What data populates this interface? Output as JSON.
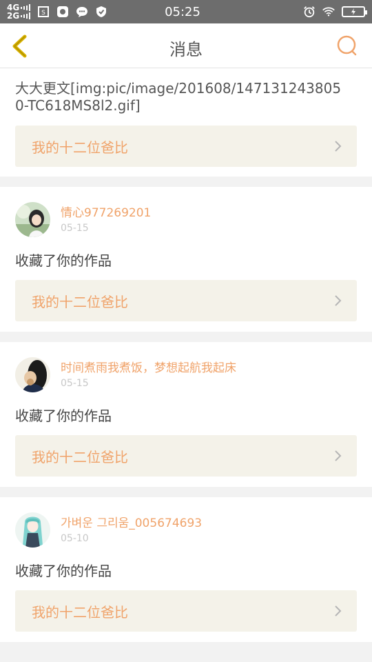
{
  "status_bar": {
    "net_top": "4G",
    "net_bottom": "2G",
    "time": "05:25"
  },
  "header": {
    "title": "消息"
  },
  "first_message": {
    "text": "大大更文[img:pic/image/201608/1471312438050-TC618MS8l2.gif]",
    "work_title": "我的十二位爸比"
  },
  "messages": [
    {
      "username": "情心977269201",
      "date": "05-15",
      "action": "收藏了你的作品",
      "work_title": "我的十二位爸比"
    },
    {
      "username": "时间煮雨我煮饭，梦想起航我起床",
      "date": "05-15",
      "action": "收藏了你的作品",
      "work_title": "我的十二位爸比"
    },
    {
      "username": "가벼운 그리움_005674693",
      "date": "05-10",
      "action": "收藏了你的作品",
      "work_title": "我的十二位爸比"
    }
  ],
  "colors": {
    "accent": "#f0a36a",
    "back_icon": "#d8b200",
    "status_bar": "#6d6d6d",
    "work_box_bg": "#f4f2e9"
  }
}
